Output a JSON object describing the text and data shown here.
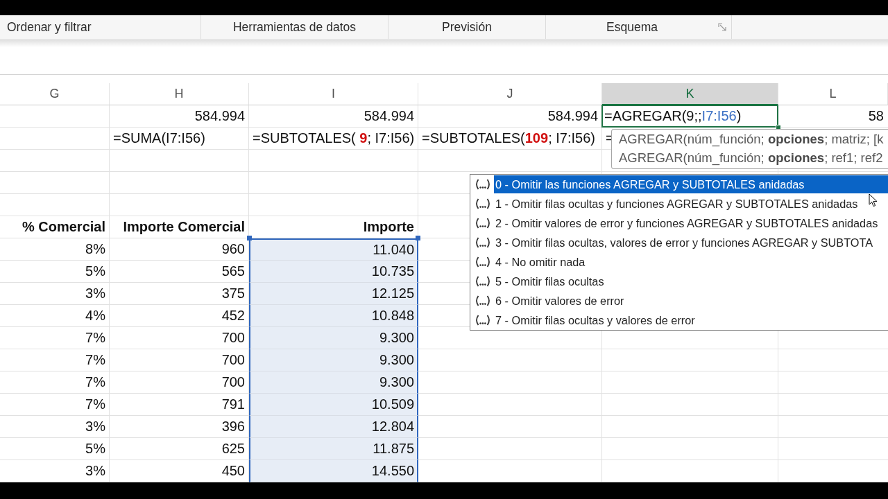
{
  "ribbon": {
    "groups": [
      {
        "label": "Ordenar y filtrar",
        "launcher": false
      },
      {
        "label": "Herramientas de datos",
        "launcher": false
      },
      {
        "label": "Previsión",
        "launcher": false
      },
      {
        "label": "Esquema",
        "launcher": true
      }
    ]
  },
  "sheet": {
    "columns": [
      {
        "label": "G",
        "selected": false
      },
      {
        "label": "H",
        "selected": false
      },
      {
        "label": "I",
        "selected": false
      },
      {
        "label": "J",
        "selected": false
      },
      {
        "label": "K",
        "selected": true
      },
      {
        "label": "L",
        "selected": false
      }
    ],
    "rows": [
      {
        "kind": "value",
        "cells": {
          "h": "584.994",
          "i": "584.994",
          "j": "584.994",
          "l": "58"
        },
        "editor": {
          "parts": [
            {
              "kind": "text",
              "text": "=AGREGAR(9;;"
            },
            {
              "kind": "reference",
              "text": "I7:I56"
            },
            {
              "kind": "text",
              "text": ")"
            }
          ]
        }
      },
      {
        "kind": "formula",
        "cells": {
          "h": "=SUMA(I7:I56)",
          "i": "=SUBTOTALES( **9**; I7:I56)",
          "j": "=SUBTOTALES(**109**; I7:I56)",
          "k": "="
        }
      },
      {
        "kind": "blank"
      },
      {
        "kind": "blank"
      },
      {
        "kind": "blank"
      },
      {
        "kind": "header",
        "cells": {
          "g": "% Comercial",
          "h": "Importe Comercial",
          "i": "Importe"
        }
      },
      {
        "kind": "data",
        "cells": {
          "g": "8%",
          "h": "960",
          "i": "11.040"
        },
        "highlighted": true
      },
      {
        "kind": "data",
        "cells": {
          "g": "5%",
          "h": "565",
          "i": "10.735"
        },
        "highlighted": true
      },
      {
        "kind": "data",
        "cells": {
          "g": "3%",
          "h": "375",
          "i": "12.125"
        },
        "highlighted": true
      },
      {
        "kind": "data",
        "cells": {
          "g": "4%",
          "h": "452",
          "i": "10.848"
        },
        "highlighted": true
      },
      {
        "kind": "data",
        "cells": {
          "g": "7%",
          "h": "700",
          "i": "9.300"
        },
        "highlighted": true
      },
      {
        "kind": "data",
        "cells": {
          "g": "7%",
          "h": "700",
          "i": "9.300"
        },
        "highlighted": true
      },
      {
        "kind": "data",
        "cells": {
          "g": "7%",
          "h": "700",
          "i": "9.300"
        },
        "highlighted": true
      },
      {
        "kind": "data",
        "cells": {
          "g": "7%",
          "h": "791",
          "i": "10.509"
        },
        "highlighted": true
      },
      {
        "kind": "data",
        "cells": {
          "g": "3%",
          "h": "396",
          "i": "12.804"
        },
        "highlighted": true
      },
      {
        "kind": "data",
        "cells": {
          "g": "5%",
          "h": "625",
          "i": "11.875"
        },
        "highlighted": true
      },
      {
        "kind": "data",
        "cells": {
          "g": "3%",
          "h": "450",
          "i": "14.550"
        },
        "highlighted": true
      }
    ]
  },
  "tooltip": {
    "lines": [
      "AGREGAR(núm_función; **opciones**; matriz; [k",
      "AGREGAR(núm_función; **opciones**; ref1; ref2"
    ]
  },
  "autocomplete": {
    "items": [
      {
        "label": "0 - Omitir las funciones AGREGAR y SUBTOTALES anidadas",
        "selected": true
      },
      {
        "label": "1 - Omitir filas ocultas y funciones AGREGAR y SUBTOTALES anidadas",
        "selected": false
      },
      {
        "label": "2 - Omitir valores de error y funciones AGREGAR y SUBTOTALES anidadas",
        "selected": false
      },
      {
        "label": "3 - Omitir filas ocultas, valores de error y funciones AGREGAR y SUBTOTA",
        "selected": false
      },
      {
        "label": "4 - No omitir nada",
        "selected": false
      },
      {
        "label": "5 - Omitir filas ocultas",
        "selected": false
      },
      {
        "label": "6 - Omitir valores de error",
        "selected": false
      },
      {
        "label": "7 - Omitir filas ocultas y valores de error",
        "selected": false
      }
    ]
  }
}
